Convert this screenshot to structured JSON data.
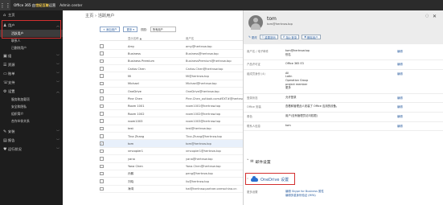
{
  "topbar": {
    "waffle_icon": "app-launcher-icon",
    "brand_prefix": "Office 365 由",
    "brand_partner": "世纪互联",
    "brand_suffix": "运营",
    "center_name": "Admin center"
  },
  "nav": {
    "items": [
      {
        "icon": "⌂",
        "label": "主页"
      },
      {
        "icon": "♟",
        "label": "用户"
      },
      {
        "icon": "▣",
        "label": "组"
      },
      {
        "icon": "☰",
        "label": "资源"
      },
      {
        "icon": "▭",
        "label": "账单"
      },
      {
        "icon": "☏",
        "label": "支持"
      },
      {
        "icon": "⚙",
        "label": "设置"
      },
      {
        "icon": "✎",
        "label": "安装"
      },
      {
        "icon": "▤",
        "label": "报告"
      },
      {
        "icon": "♥",
        "label": "运行状况"
      }
    ],
    "users_sub": [
      "活跃用户",
      "联系人",
      "已删除用户"
    ],
    "settings_sub": [
      "服务和加载项",
      "安全和隐私",
      "组织简介",
      "合作伙伴关系"
    ]
  },
  "main": {
    "breadcrumb": "主页 › 活跃用户",
    "toolbar": {
      "add_user": "+ 添加用户",
      "more": "更多 ▾",
      "view_label": "视图:",
      "view_value": "所有用户"
    },
    "columns": {
      "display_name": "显示名称 ▲",
      "username": "用户名"
    },
    "rows": [
      {
        "name": "Amy",
        "email": "amy@hertnsw.top",
        "selected": false
      },
      {
        "name": "Business",
        "email": "Business@hertnsw.top",
        "selected": false
      },
      {
        "name": "Business Premium",
        "email": "BusinessPremium@hertnsw.top",
        "selected": false
      },
      {
        "name": "Carlos Chen",
        "email": "Carlos.Chen@hertnsw.top",
        "selected": false
      },
      {
        "name": "Mi",
        "email": "Mi@hertnsw.top",
        "selected": false
      },
      {
        "name": "Michael",
        "email": "Michael@hertnsw.top",
        "selected": false
      },
      {
        "name": "OneDrive",
        "email": "OneDrive@hertnsw.top",
        "selected": false
      },
      {
        "name": "Pine Chen",
        "email": "Pine.Chen_outlook.com#EXT#@hertnsw.top",
        "selected": false
      },
      {
        "name": "Room 1001",
        "email": "room1001@hertnsw.top",
        "selected": false
      },
      {
        "name": "Room 1002",
        "email": "room1002@hertnsw.top",
        "selected": false
      },
      {
        "name": "room1003",
        "email": "room1003@hertnsw.top",
        "selected": false
      },
      {
        "name": "test",
        "email": "test@hertnsw.top",
        "selected": false
      },
      {
        "name": "Tina Zhang",
        "email": "Tina.Zhang@hertnsw.top",
        "selected": false
      },
      {
        "name": "tom",
        "email": "tom@hertnsw.top",
        "selected": true
      },
      {
        "name": "vmcopier1",
        "email": "vmcopier1@hertnsw.top",
        "selected": false
      },
      {
        "name": "yana",
        "email": "yana@hertnsw.top",
        "selected": false
      },
      {
        "name": "Yana Chen",
        "email": "Yana.Chen@hertnsw.top",
        "selected": false
      },
      {
        "name": "孙鹏",
        "email": "peng@hertnsw.top",
        "selected": false
      },
      {
        "name": "刘晓",
        "email": "liu@hertnsw.top",
        "selected": false
      },
      {
        "name": "海湾",
        "email": "hai@hertnsw.partner.onmschina.cn",
        "selected": false
      }
    ]
  },
  "panel": {
    "name": "tom",
    "email": "tom@hertnsw.top",
    "actions": [
      "更改",
      "重置密码",
      "阻止登录",
      "删除用户"
    ],
    "properties": [
      {
        "key": "用户名 / 电子邮件",
        "values": [
          "tom@hertnsw.top",
          "别名"
        ],
        "edit": "编辑"
      },
      {
        "key": "产品许可证",
        "values": [
          "Office 365 E3"
        ],
        "edit": "编辑"
      },
      {
        "key": "组成员身份 (4)",
        "values": [
          "All",
          "Latin",
          "Operation Group",
          "project member",
          "更多"
        ],
        "edit": "编辑"
      },
      {
        "key": "登录状态",
        "values": [
          "允许登录"
        ],
        "edit": "编辑"
      },
      {
        "key": "Office 安装",
        "values": [
          "查看和管理此人安装了 Office 应用的设备。"
        ],
        "edit": "编辑"
      },
      {
        "key": "角色",
        "values": [
          "用户(没有管理员访问权限)"
        ],
        "edit": "编辑"
      },
      {
        "key": "联系人信息",
        "values": [
          "tom"
        ],
        "edit": "编辑"
      }
    ],
    "mail_section": "邮件设置",
    "onedrive_label": "OneDrive 设置",
    "more_settings": {
      "key": "更多设置",
      "links": [
        "编辑 Skype for Business 属性",
        "编辑多重身份验证 (MFA)"
      ]
    }
  },
  "colors": {
    "highlight": "#d32f2f",
    "link": "#2a5d9f",
    "nav_bg": "#1d1d1d",
    "topbar_bg": "#2b2b2b"
  }
}
